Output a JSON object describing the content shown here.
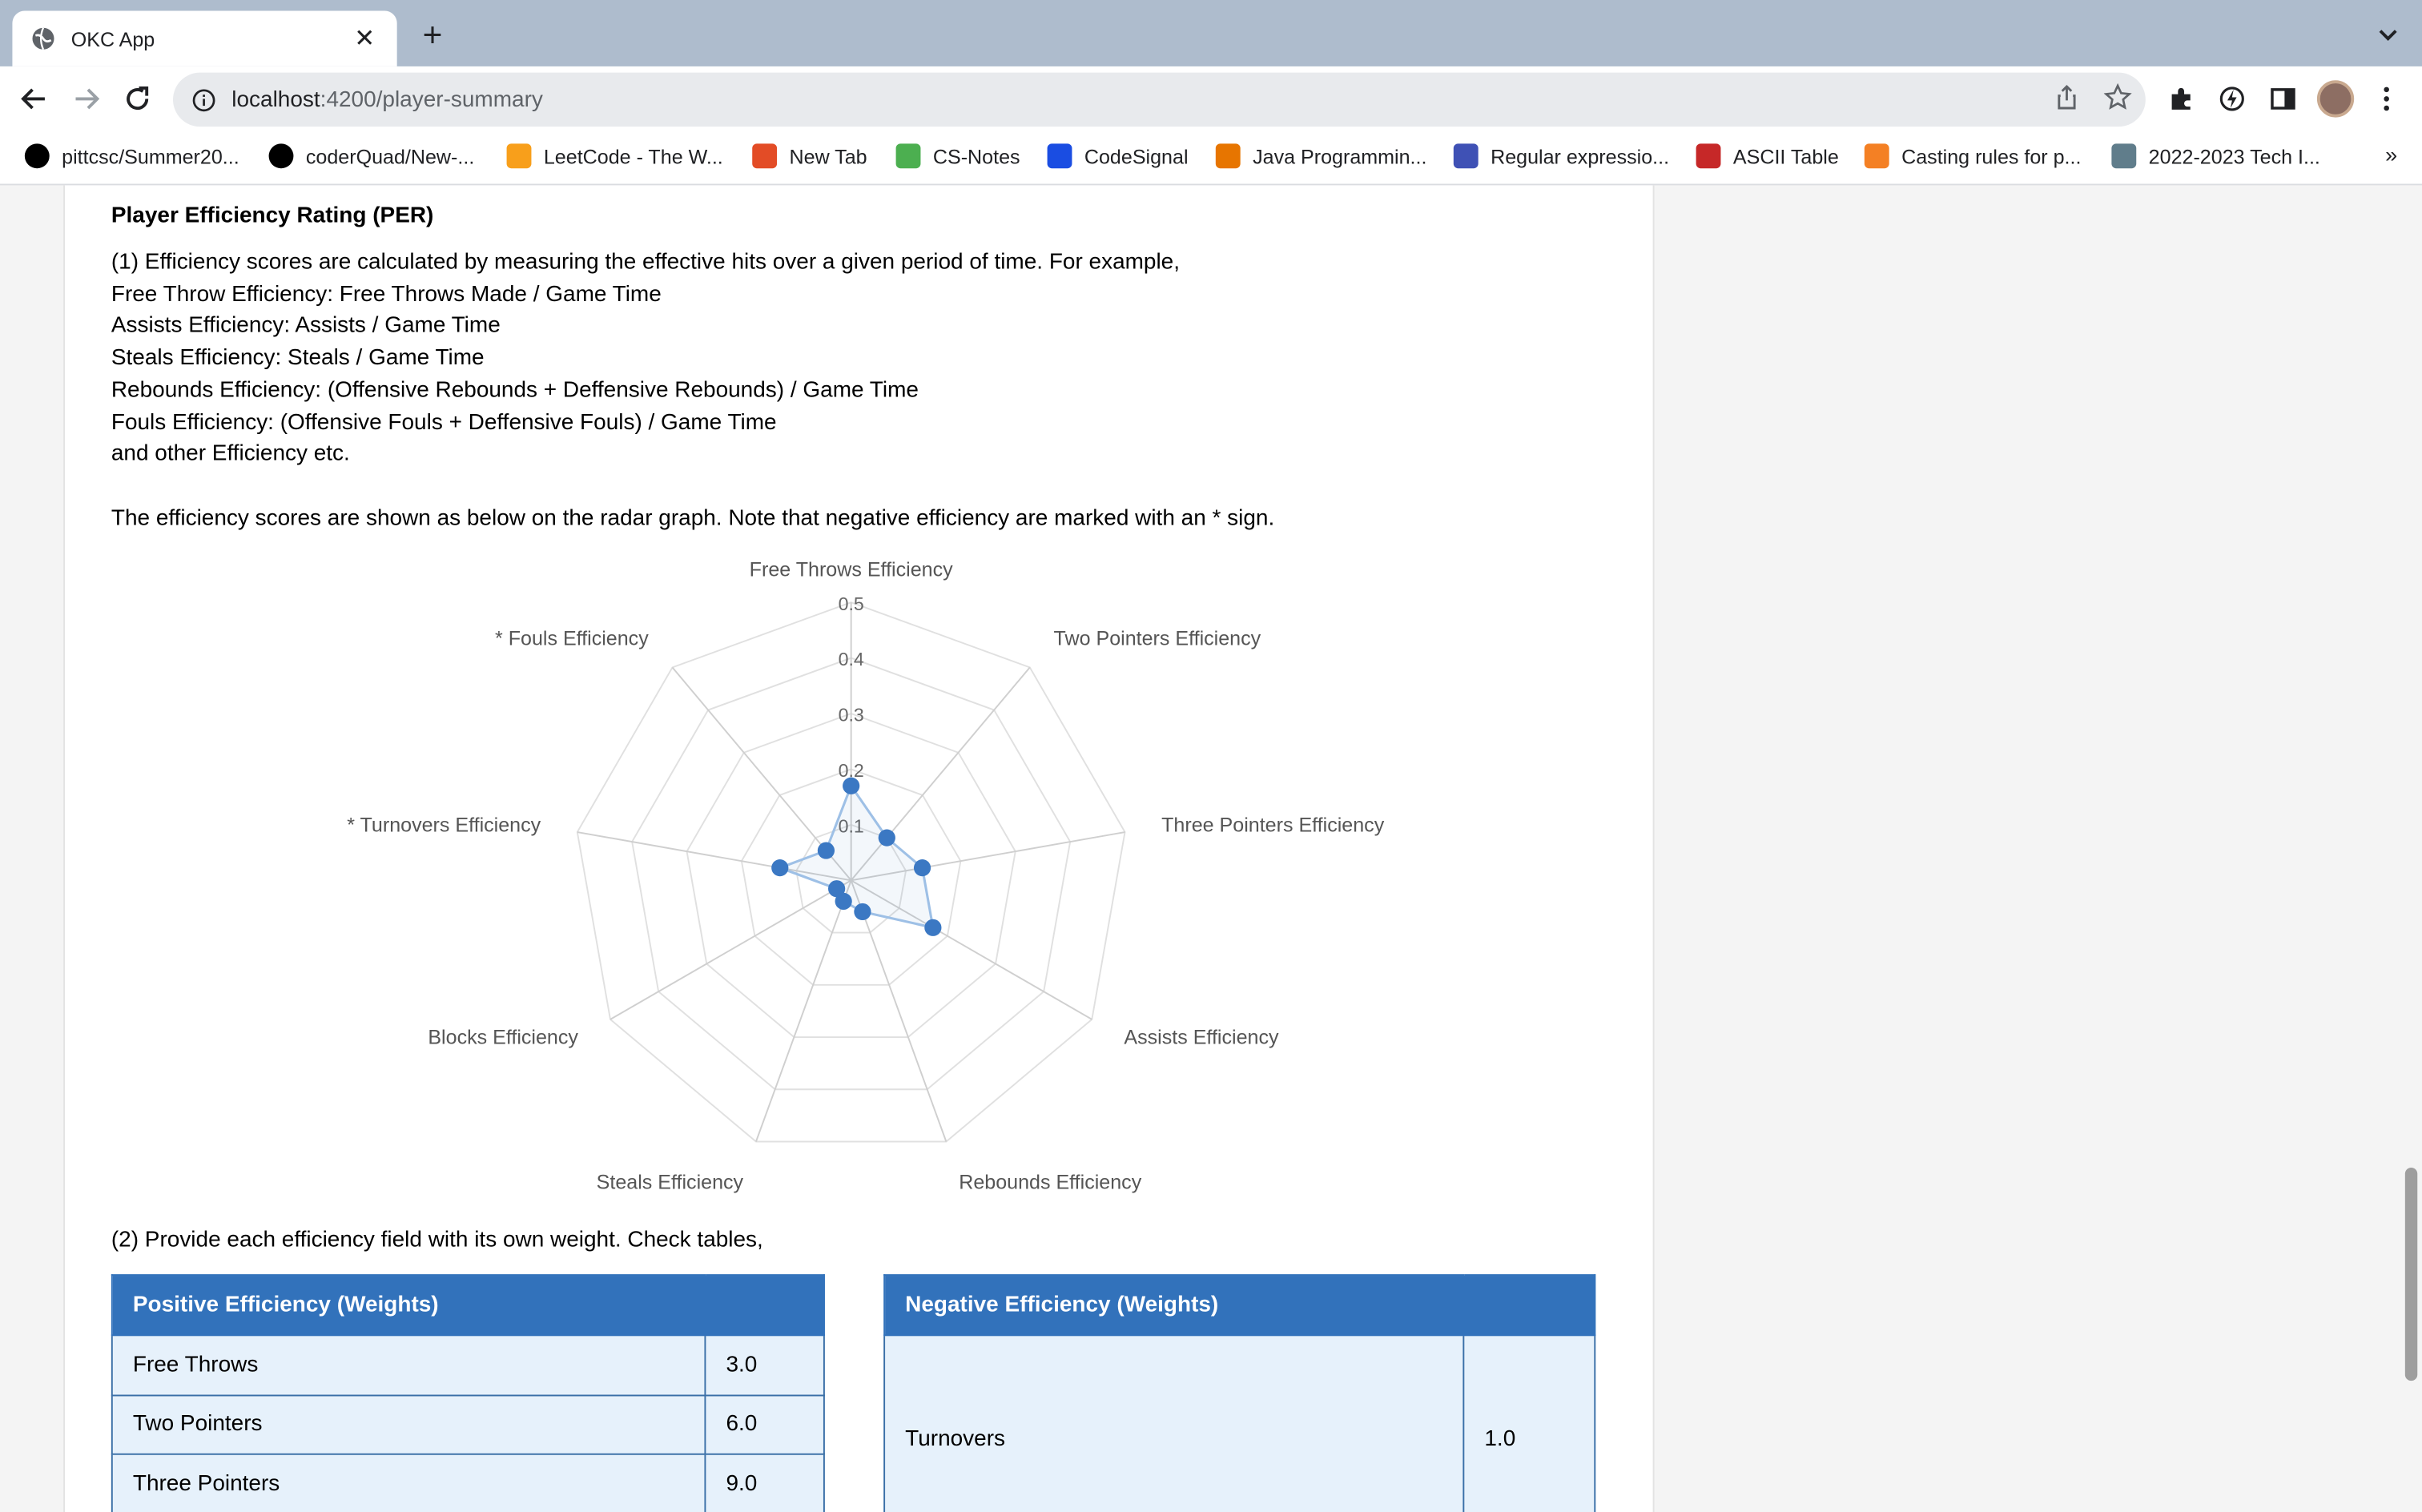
{
  "browser": {
    "tab_title": "OKC App",
    "url_host": "localhost",
    "url_rest": ":4200/player-summary",
    "bookmarks": [
      {
        "label": "pittcsc/Summer20...",
        "icon": "github-icon",
        "color": "#000000"
      },
      {
        "label": "coderQuad/New-...",
        "icon": "github-icon",
        "color": "#000000"
      },
      {
        "label": "LeetCode - The W...",
        "icon": "leetcode-icon",
        "color": "#f89f1b"
      },
      {
        "label": "New Tab",
        "icon": "newtab-icon",
        "color": "#e34c26"
      },
      {
        "label": "CS-Notes",
        "icon": "notes-icon",
        "color": "#4caf50"
      },
      {
        "label": "CodeSignal",
        "icon": "codesignal-icon",
        "color": "#1a4de2"
      },
      {
        "label": "Java Programmin...",
        "icon": "princeton-icon",
        "color": "#e77500"
      },
      {
        "label": "Regular expressio...",
        "icon": "regex-icon",
        "color": "#3f51b5"
      },
      {
        "label": "ASCII Table",
        "icon": "ascii-icon",
        "color": "#c62828"
      },
      {
        "label": "Casting rules for p...",
        "icon": "stackoverflow-icon",
        "color": "#f48024"
      },
      {
        "label": "2022-2023 Tech I...",
        "icon": "sheet-icon",
        "color": "#607d8b"
      }
    ],
    "bookmarks_more": "»"
  },
  "content": {
    "section_title": "Player Efficiency Rating (PER)",
    "lines": [
      "(1) Efficiency scores are calculated by measuring the effective hits over a given period of time. For example,",
      "Free Throw Efficiency: Free Throws Made / Game Time",
      "Assists Efficiency: Assists / Game Time",
      "Steals Efficiency: Steals / Game Time",
      "Rebounds Efficiency: (Offensive Rebounds + Deffensive Rebounds) / Game Time",
      "Fouls Efficiency: (Offensive Fouls + Deffensive Fouls) / Game Time",
      "and other Efficiency etc."
    ],
    "note": "The efficiency scores are shown as below on the radar graph. Note that negative efficiency are marked with an * sign.",
    "weights_intro": "(2) Provide each efficiency field with its own weight. Check tables,"
  },
  "chart_data": {
    "type": "radar",
    "axes": [
      "Free Throws Efficiency",
      "Two Pointers Efficiency",
      "Three Pointers Efficiency",
      "Assists Efficiency",
      "Rebounds Efficiency",
      "Steals Efficiency",
      "Blocks Efficiency",
      "* Turnovers Efficiency",
      "* Fouls Efficiency"
    ],
    "ticks": [
      "0.1",
      "0.2",
      "0.3",
      "0.4",
      "0.5"
    ],
    "rmax": 0.5,
    "series": [
      {
        "values": [
          0.17,
          0.1,
          0.13,
          0.17,
          0.06,
          0.04,
          0.03,
          0.13,
          0.07
        ],
        "color": "#3b78c3"
      }
    ]
  },
  "positive_table": {
    "header": "Positive Efficiency (Weights)",
    "rows": [
      {
        "name": "Free Throws",
        "weight": "3.0"
      },
      {
        "name": "Two Pointers",
        "weight": "6.0"
      },
      {
        "name": "Three Pointers",
        "weight": "9.0"
      }
    ]
  },
  "negative_table": {
    "header": "Negative Efficiency (Weights)",
    "rows": [
      {
        "name": "Turnovers",
        "weight": "1.0"
      }
    ]
  }
}
